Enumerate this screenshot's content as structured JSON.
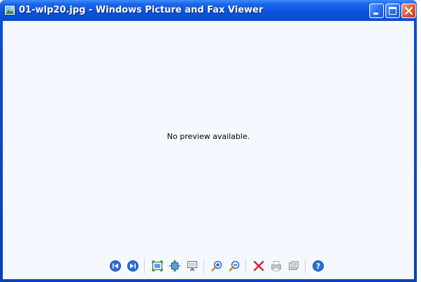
{
  "window": {
    "title": "01-wlp20.jpg - Windows Picture and Fax Viewer",
    "app_icon": "picture-viewer-icon",
    "controls": [
      "minimize-icon",
      "maximize-icon",
      "close-icon"
    ]
  },
  "content": {
    "message": "No preview available."
  },
  "toolbar": {
    "buttons": [
      {
        "name": "previous-image",
        "icon": "previous-arrow-icon"
      },
      {
        "name": "next-image",
        "icon": "next-arrow-icon"
      },
      {
        "name": "best-fit",
        "icon": "best-fit-icon"
      },
      {
        "name": "actual-size",
        "icon": "actual-size-icon"
      },
      {
        "name": "slide-show",
        "icon": "slideshow-icon"
      },
      {
        "name": "zoom-in",
        "icon": "zoom-in-icon"
      },
      {
        "name": "zoom-out",
        "icon": "zoom-out-icon"
      },
      {
        "name": "delete",
        "icon": "delete-icon"
      },
      {
        "name": "print",
        "icon": "print-icon"
      },
      {
        "name": "copy-to",
        "icon": "save-copy-icon"
      },
      {
        "name": "help",
        "icon": "help-icon"
      }
    ]
  },
  "colors": {
    "titlebar": "#0a4fd6",
    "client_background": "#f5f8ff",
    "close_button": "#e2593a"
  }
}
